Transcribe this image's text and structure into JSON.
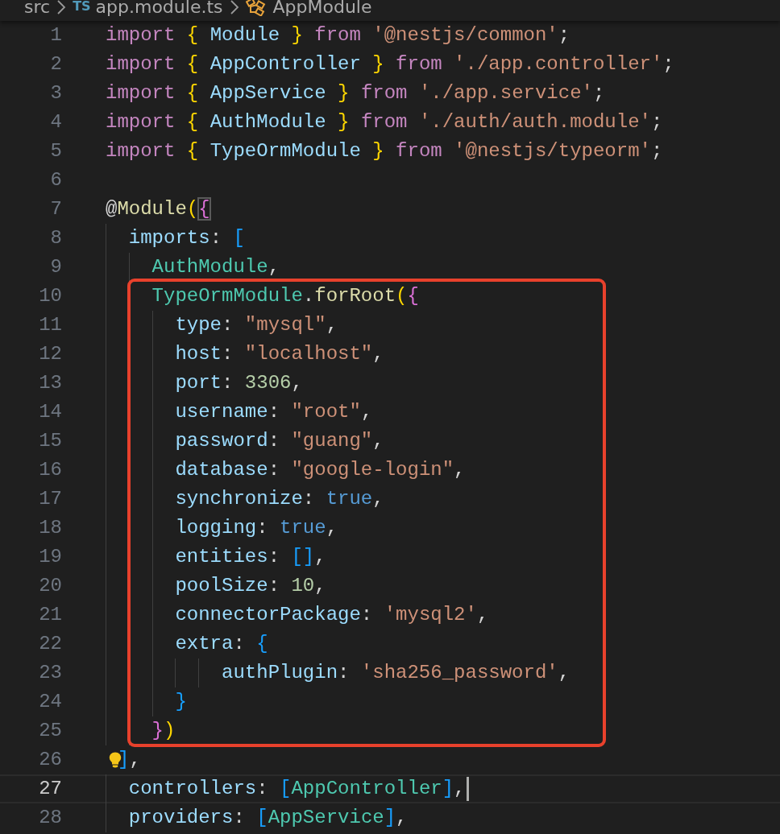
{
  "breadcrumb": {
    "items": [
      {
        "kind": "folder",
        "label": "src"
      },
      {
        "kind": "file",
        "badge": "TS",
        "label": "app.module.ts"
      },
      {
        "kind": "symbol",
        "label": "AppModule"
      }
    ]
  },
  "editor": {
    "blocks": [
      {
        "framed": false,
        "lines": [
          {
            "number": "1",
            "current": false,
            "tokens": [
              {
                "t": "import ",
                "kind": "kw"
              },
              {
                "t": "{ ",
                "kind": "brace"
              },
              {
                "t": "Module ",
                "kind": "var"
              },
              {
                "t": "} ",
                "kind": "brace"
              },
              {
                "t": "from ",
                "kind": "kw"
              },
              {
                "t": "'@nestjs/common'",
                "kind": "str"
              },
              {
                "t": ";",
                "kind": "punct"
              }
            ]
          },
          {
            "number": "2",
            "current": false,
            "tokens": [
              {
                "t": "import ",
                "kind": "kw"
              },
              {
                "t": "{ ",
                "kind": "brace"
              },
              {
                "t": "AppController ",
                "kind": "var"
              },
              {
                "t": "} ",
                "kind": "brace"
              },
              {
                "t": "from ",
                "kind": "kw"
              },
              {
                "t": "'./app.controller'",
                "kind": "str"
              },
              {
                "t": ";",
                "kind": "punct"
              }
            ]
          },
          {
            "number": "3",
            "current": false,
            "tokens": [
              {
                "t": "import ",
                "kind": "kw"
              },
              {
                "t": "{ ",
                "kind": "brace"
              },
              {
                "t": "AppService ",
                "kind": "var"
              },
              {
                "t": "} ",
                "kind": "brace"
              },
              {
                "t": "from ",
                "kind": "kw"
              },
              {
                "t": "'./app.service'",
                "kind": "str"
              },
              {
                "t": ";",
                "kind": "punct"
              }
            ]
          },
          {
            "number": "4",
            "current": false,
            "tokens": [
              {
                "t": "import ",
                "kind": "kw"
              },
              {
                "t": "{ ",
                "kind": "brace"
              },
              {
                "t": "AuthModule ",
                "kind": "var"
              },
              {
                "t": "} ",
                "kind": "brace"
              },
              {
                "t": "from ",
                "kind": "kw"
              },
              {
                "t": "'./auth/auth.module'",
                "kind": "str"
              },
              {
                "t": ";",
                "kind": "punct"
              }
            ]
          },
          {
            "number": "5",
            "current": false,
            "tokens": [
              {
                "t": "import ",
                "kind": "kw"
              },
              {
                "t": "{ ",
                "kind": "brace"
              },
              {
                "t": "TypeOrmModule ",
                "kind": "var"
              },
              {
                "t": "} ",
                "kind": "brace"
              },
              {
                "t": "from ",
                "kind": "kw"
              },
              {
                "t": "'@nestjs/typeorm'",
                "kind": "str"
              },
              {
                "t": ";",
                "kind": "punct"
              }
            ]
          },
          {
            "number": "6",
            "current": false
          },
          {
            "number": "7",
            "current": false,
            "tokens": [
              {
                "t": "@",
                "kind": "punct"
              },
              {
                "t": "Module",
                "kind": "fn"
              },
              {
                "t": "(",
                "kind": "brace"
              },
              {
                "t": "{",
                "kind": "pinkmatch"
              }
            ]
          },
          {
            "number": "8",
            "current": false,
            "tokens": [
              {
                "t": "  imports",
                "kind": "var"
              },
              {
                "t": ": ",
                "kind": "punct"
              },
              {
                "t": "[",
                "kind": "blue"
              }
            ]
          },
          {
            "number": "9",
            "current": false,
            "tokens": [
              {
                "t": "    AuthModule",
                "kind": "cls"
              },
              {
                "t": ",",
                "kind": "punct"
              }
            ]
          }
        ]
      },
      {
        "framed": true,
        "lines": [
          {
            "number": "10",
            "current": false,
            "tokens": [
              {
                "t": "    TypeOrmModule",
                "kind": "cls"
              },
              {
                "t": ".",
                "kind": "punct"
              },
              {
                "t": "forRoot",
                "kind": "fn"
              },
              {
                "t": "(",
                "kind": "brace"
              },
              {
                "t": "{",
                "kind": "pink"
              }
            ]
          },
          {
            "number": "11",
            "current": false,
            "tokens": [
              {
                "t": "      type",
                "kind": "var"
              },
              {
                "t": ": ",
                "kind": "punct"
              },
              {
                "t": "\"mysql\"",
                "kind": "str"
              },
              {
                "t": ",",
                "kind": "punct"
              }
            ]
          },
          {
            "number": "12",
            "current": false,
            "tokens": [
              {
                "t": "      host",
                "kind": "var"
              },
              {
                "t": ": ",
                "kind": "punct"
              },
              {
                "t": "\"localhost\"",
                "kind": "str"
              },
              {
                "t": ",",
                "kind": "punct"
              }
            ]
          },
          {
            "number": "13",
            "current": false,
            "tokens": [
              {
                "t": "      port",
                "kind": "var"
              },
              {
                "t": ": ",
                "kind": "punct"
              },
              {
                "t": "3306",
                "kind": "num"
              },
              {
                "t": ",",
                "kind": "punct"
              }
            ]
          },
          {
            "number": "14",
            "current": false,
            "tokens": [
              {
                "t": "      username",
                "kind": "var"
              },
              {
                "t": ": ",
                "kind": "punct"
              },
              {
                "t": "\"root\"",
                "kind": "str"
              },
              {
                "t": ",",
                "kind": "punct"
              }
            ]
          },
          {
            "number": "15",
            "current": false,
            "tokens": [
              {
                "t": "      password",
                "kind": "var"
              },
              {
                "t": ": ",
                "kind": "punct"
              },
              {
                "t": "\"guang\"",
                "kind": "str"
              },
              {
                "t": ",",
                "kind": "punct"
              }
            ]
          },
          {
            "number": "16",
            "current": false,
            "tokens": [
              {
                "t": "      database",
                "kind": "var"
              },
              {
                "t": ": ",
                "kind": "punct"
              },
              {
                "t": "\"google-login\"",
                "kind": "str"
              },
              {
                "t": ",",
                "kind": "punct"
              }
            ]
          },
          {
            "number": "17",
            "current": false,
            "tokens": [
              {
                "t": "      synchronize",
                "kind": "var"
              },
              {
                "t": ": ",
                "kind": "punct"
              },
              {
                "t": "true",
                "kind": "const"
              },
              {
                "t": ",",
                "kind": "punct"
              }
            ]
          },
          {
            "number": "18",
            "current": false,
            "tokens": [
              {
                "t": "      logging",
                "kind": "var"
              },
              {
                "t": ": ",
                "kind": "punct"
              },
              {
                "t": "true",
                "kind": "const"
              },
              {
                "t": ",",
                "kind": "punct"
              }
            ]
          },
          {
            "number": "19",
            "current": false,
            "tokens": [
              {
                "t": "      entities",
                "kind": "var"
              },
              {
                "t": ": ",
                "kind": "punct"
              },
              {
                "t": "[]",
                "kind": "blue"
              },
              {
                "t": ",",
                "kind": "punct"
              }
            ]
          },
          {
            "number": "20",
            "current": false,
            "tokens": [
              {
                "t": "      poolSize",
                "kind": "var"
              },
              {
                "t": ": ",
                "kind": "punct"
              },
              {
                "t": "10",
                "kind": "num"
              },
              {
                "t": ",",
                "kind": "punct"
              }
            ]
          },
          {
            "number": "21",
            "current": false,
            "tokens": [
              {
                "t": "      connectorPackage",
                "kind": "var"
              },
              {
                "t": ": ",
                "kind": "punct"
              },
              {
                "t": "'mysql2'",
                "kind": "str"
              },
              {
                "t": ",",
                "kind": "punct"
              }
            ]
          },
          {
            "number": "22",
            "current": false,
            "tokens": [
              {
                "t": "      extra",
                "kind": "var"
              },
              {
                "t": ": ",
                "kind": "punct"
              },
              {
                "t": "{",
                "kind": "blue"
              }
            ]
          },
          {
            "number": "23",
            "current": false,
            "tokens": [
              {
                "t": "          authPlugin",
                "kind": "var"
              },
              {
                "t": ": ",
                "kind": "punct"
              },
              {
                "t": "'sha256_password'",
                "kind": "str"
              },
              {
                "t": ",",
                "kind": "punct"
              }
            ]
          },
          {
            "number": "24",
            "current": false,
            "tokens": [
              {
                "t": "      }",
                "kind": "blue"
              }
            ]
          },
          {
            "number": "25",
            "current": false,
            "tokens": [
              {
                "t": "    }",
                "kind": "pink"
              },
              {
                "t": ")",
                "kind": "brace"
              }
            ]
          }
        ]
      },
      {
        "framed": false,
        "lines": [
          {
            "number": "26",
            "current": false,
            "lightbulb": true,
            "tokens": [
              {
                "t": "]",
                "kind": "blue"
              },
              {
                "t": ",",
                "kind": "punct"
              }
            ]
          },
          {
            "number": "27",
            "current": true,
            "tokens": [
              {
                "t": "  controllers",
                "kind": "var"
              },
              {
                "t": ": ",
                "kind": "punct"
              },
              {
                "t": "[",
                "kind": "blue"
              },
              {
                "t": "AppController",
                "kind": "cls"
              },
              {
                "t": "]",
                "kind": "blue"
              },
              {
                "t": ",",
                "kind": "punct"
              }
            ]
          },
          {
            "number": "28",
            "current": false,
            "tokens": [
              {
                "t": "  providers",
                "kind": "var"
              },
              {
                "t": ": ",
                "kind": "punct"
              },
              {
                "t": "[",
                "kind": "blue"
              },
              {
                "t": "AppService",
                "kind": "cls"
              },
              {
                "t": "]",
                "kind": "blue"
              },
              {
                "t": ",",
                "kind": "punct"
              }
            ]
          }
        ]
      }
    ]
  }
}
